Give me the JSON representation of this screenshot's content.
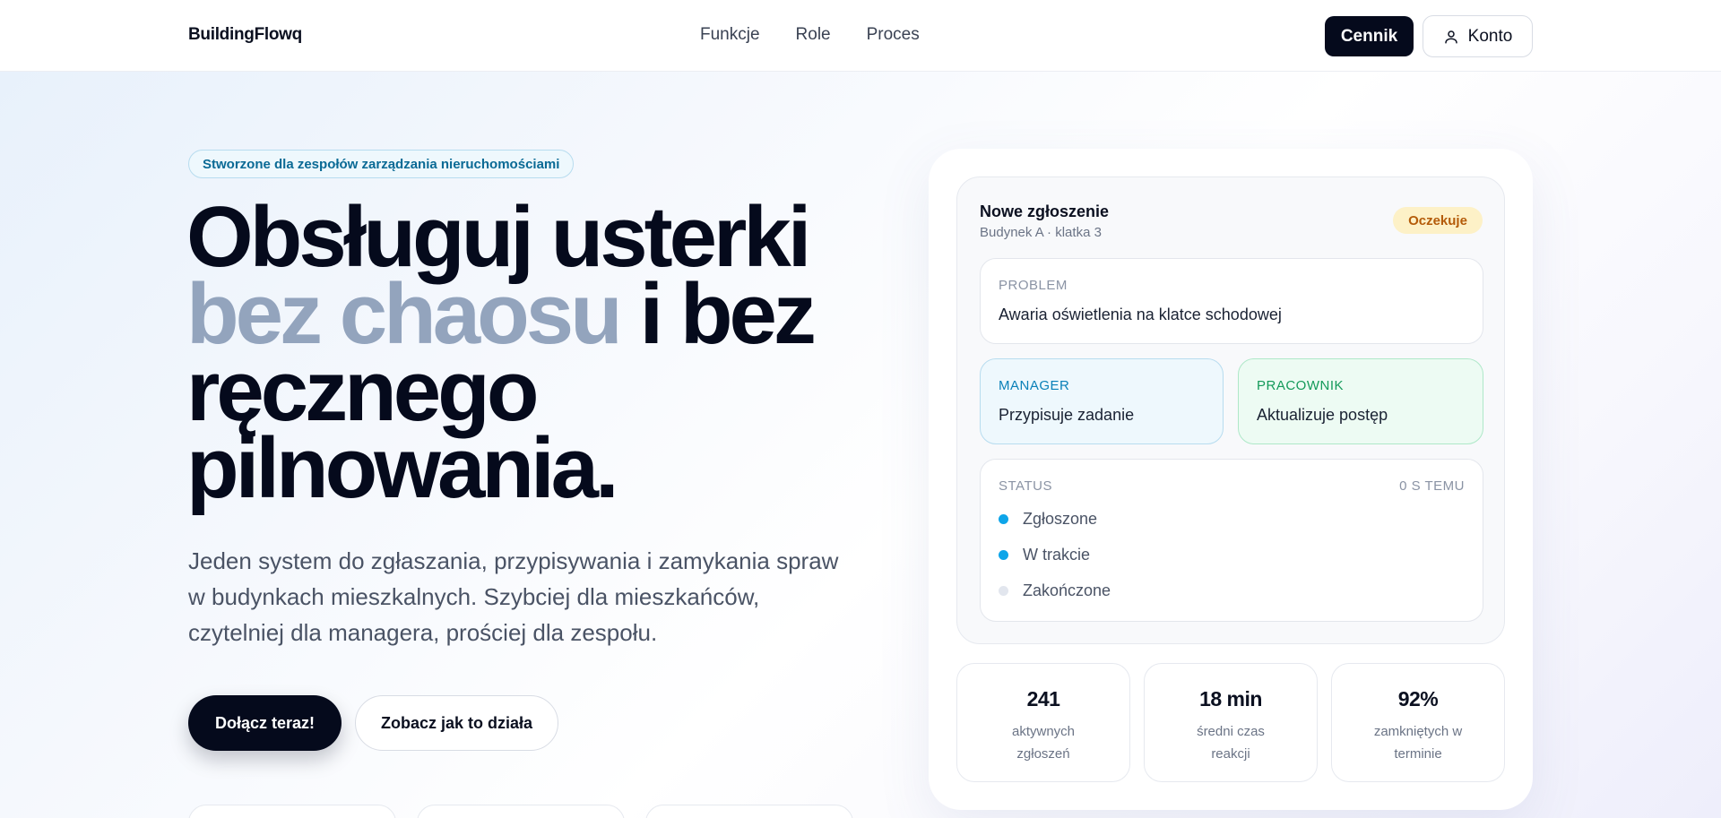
{
  "header": {
    "logo": "BuildingFlowq",
    "nav": [
      "Funkcje",
      "Role",
      "Proces"
    ],
    "pricing_label": "Cennik",
    "account_label": "Konto"
  },
  "hero": {
    "pill": "Stworzone dla zespołów zarządzania nieruchomościami",
    "title_line1": "Obsługuj usterki",
    "title_muted": "bez chaosu",
    "title_rest": " i bez",
    "title_line3": "ręcznego",
    "title_line4": "pilnowania.",
    "subtitle": "Jeden system do zgłaszania, przypisywania i zamykania spraw w budynkach mieszkalnych. Szybciej dla mieszkańców, czytelniej dla managera, prościej dla zespołu.",
    "cta_primary": "Dołącz teraz!",
    "cta_secondary": "Zobacz jak to działa"
  },
  "ticket": {
    "title": "Nowe zgłoszenie",
    "location": "Budynek A · klatka 3",
    "badge": "Oczekuje",
    "problem_label": "PROBLEM",
    "problem_value": "Awaria oświetlenia na klatce schodowej",
    "manager_label": "MANAGER",
    "manager_value": "Przypisuje zadanie",
    "worker_label": "PRACOWNIK",
    "worker_value": "Aktualizuje postęp",
    "status_label": "STATUS",
    "status_ago": "0 S TEMU",
    "statuses": [
      {
        "label": "Zgłoszone",
        "active": true
      },
      {
        "label": "W trakcie",
        "active": true
      },
      {
        "label": "Zakończone",
        "active": false
      }
    ]
  },
  "stats": [
    {
      "value": "241",
      "caption": "aktywnych zgłoszeń"
    },
    {
      "value": "18 min",
      "caption": "średni czas reakcji"
    },
    {
      "value": "92%",
      "caption": "zamkniętych w terminie"
    }
  ],
  "colors": {
    "primary": "#050a1c",
    "accent": "#0ea5e9",
    "muted_title": "#93a4bd",
    "pending": "#b45b09",
    "inactive_dot": "#e2e6ee"
  }
}
